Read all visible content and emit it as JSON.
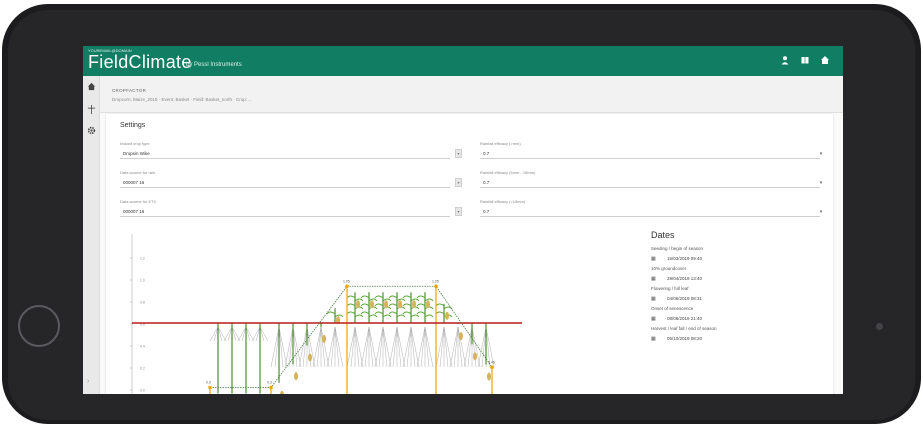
{
  "app": {
    "login_text": "YOUREMAIL@DOMAIN",
    "logo_main": "FieldClimate",
    "logo_by": "by Pessl Instruments",
    "accent": "#117d62"
  },
  "topbar_icons": [
    "user-icon",
    "book-icon",
    "home-icon"
  ],
  "sidebar_icons": [
    "home-icon",
    "station-icon",
    "settings-icon"
  ],
  "header": {
    "title": "CROPFACTOR",
    "breadcrumb": "Dropcorn, Maize_2015 · Event: Basket · Field: Basket_north · Crop: ..."
  },
  "settings": {
    "title": "Settings",
    "left_fields": [
      {
        "label": "Instant crop type",
        "value": "Dropsin Wike"
      },
      {
        "label": "Data source for rain",
        "value": "000007 16"
      },
      {
        "label": "Data source for ET0",
        "value": "000007 16"
      }
    ],
    "right_fields": [
      {
        "label": "Rainfall efficacy (>mm)",
        "value": "0.7"
      },
      {
        "label": "Rainfall efficacy (5mm - 15mm)",
        "value": "0.7"
      },
      {
        "label": "Rainfall efficacy (>15mm)",
        "value": "0.7"
      }
    ]
  },
  "dates": {
    "title": "Dates",
    "items": [
      {
        "label": "Seeding / begin of season",
        "value": "15/03/2019 09:40"
      },
      {
        "label": "10% groundcover",
        "value": "29/04/2019 13:40"
      },
      {
        "label": "Flowering / full leaf",
        "value": "04/06/2019 08:31"
      },
      {
        "label": "Onset of senescence",
        "value": "08/08/2019 21:40"
      },
      {
        "label": "Harvest / leaf fall / end of season",
        "value": "05/10/2019 08:20"
      }
    ]
  },
  "chart_data": {
    "type": "line",
    "title": "",
    "xlabel": "",
    "ylabel": "",
    "y_ticks": [
      "0.0",
      "0.2",
      "0.4",
      "0.6",
      "0.8",
      "1.0",
      "1.2"
    ],
    "kc_points": [
      {
        "x": 0,
        "y": 0.3,
        "label": "0.3"
      },
      {
        "x": 1,
        "y": 0.3,
        "label": "0.3"
      },
      {
        "x": 2,
        "y": 1.05,
        "label": "1.05"
      },
      {
        "x": 3,
        "y": 1.05,
        "label": "1.05"
      },
      {
        "x": 4,
        "y": 0.45,
        "label": "0.45"
      }
    ],
    "stage_boundaries": [
      0,
      1,
      2,
      3,
      4
    ],
    "x_labels": [
      "0.6",
      "0.6",
      "0.6",
      "0.6",
      "0.6"
    ],
    "soil_line_color": "#b81c1c",
    "kc_line_color": "#3f7f3a",
    "stage_line_color": "#f0a400"
  }
}
